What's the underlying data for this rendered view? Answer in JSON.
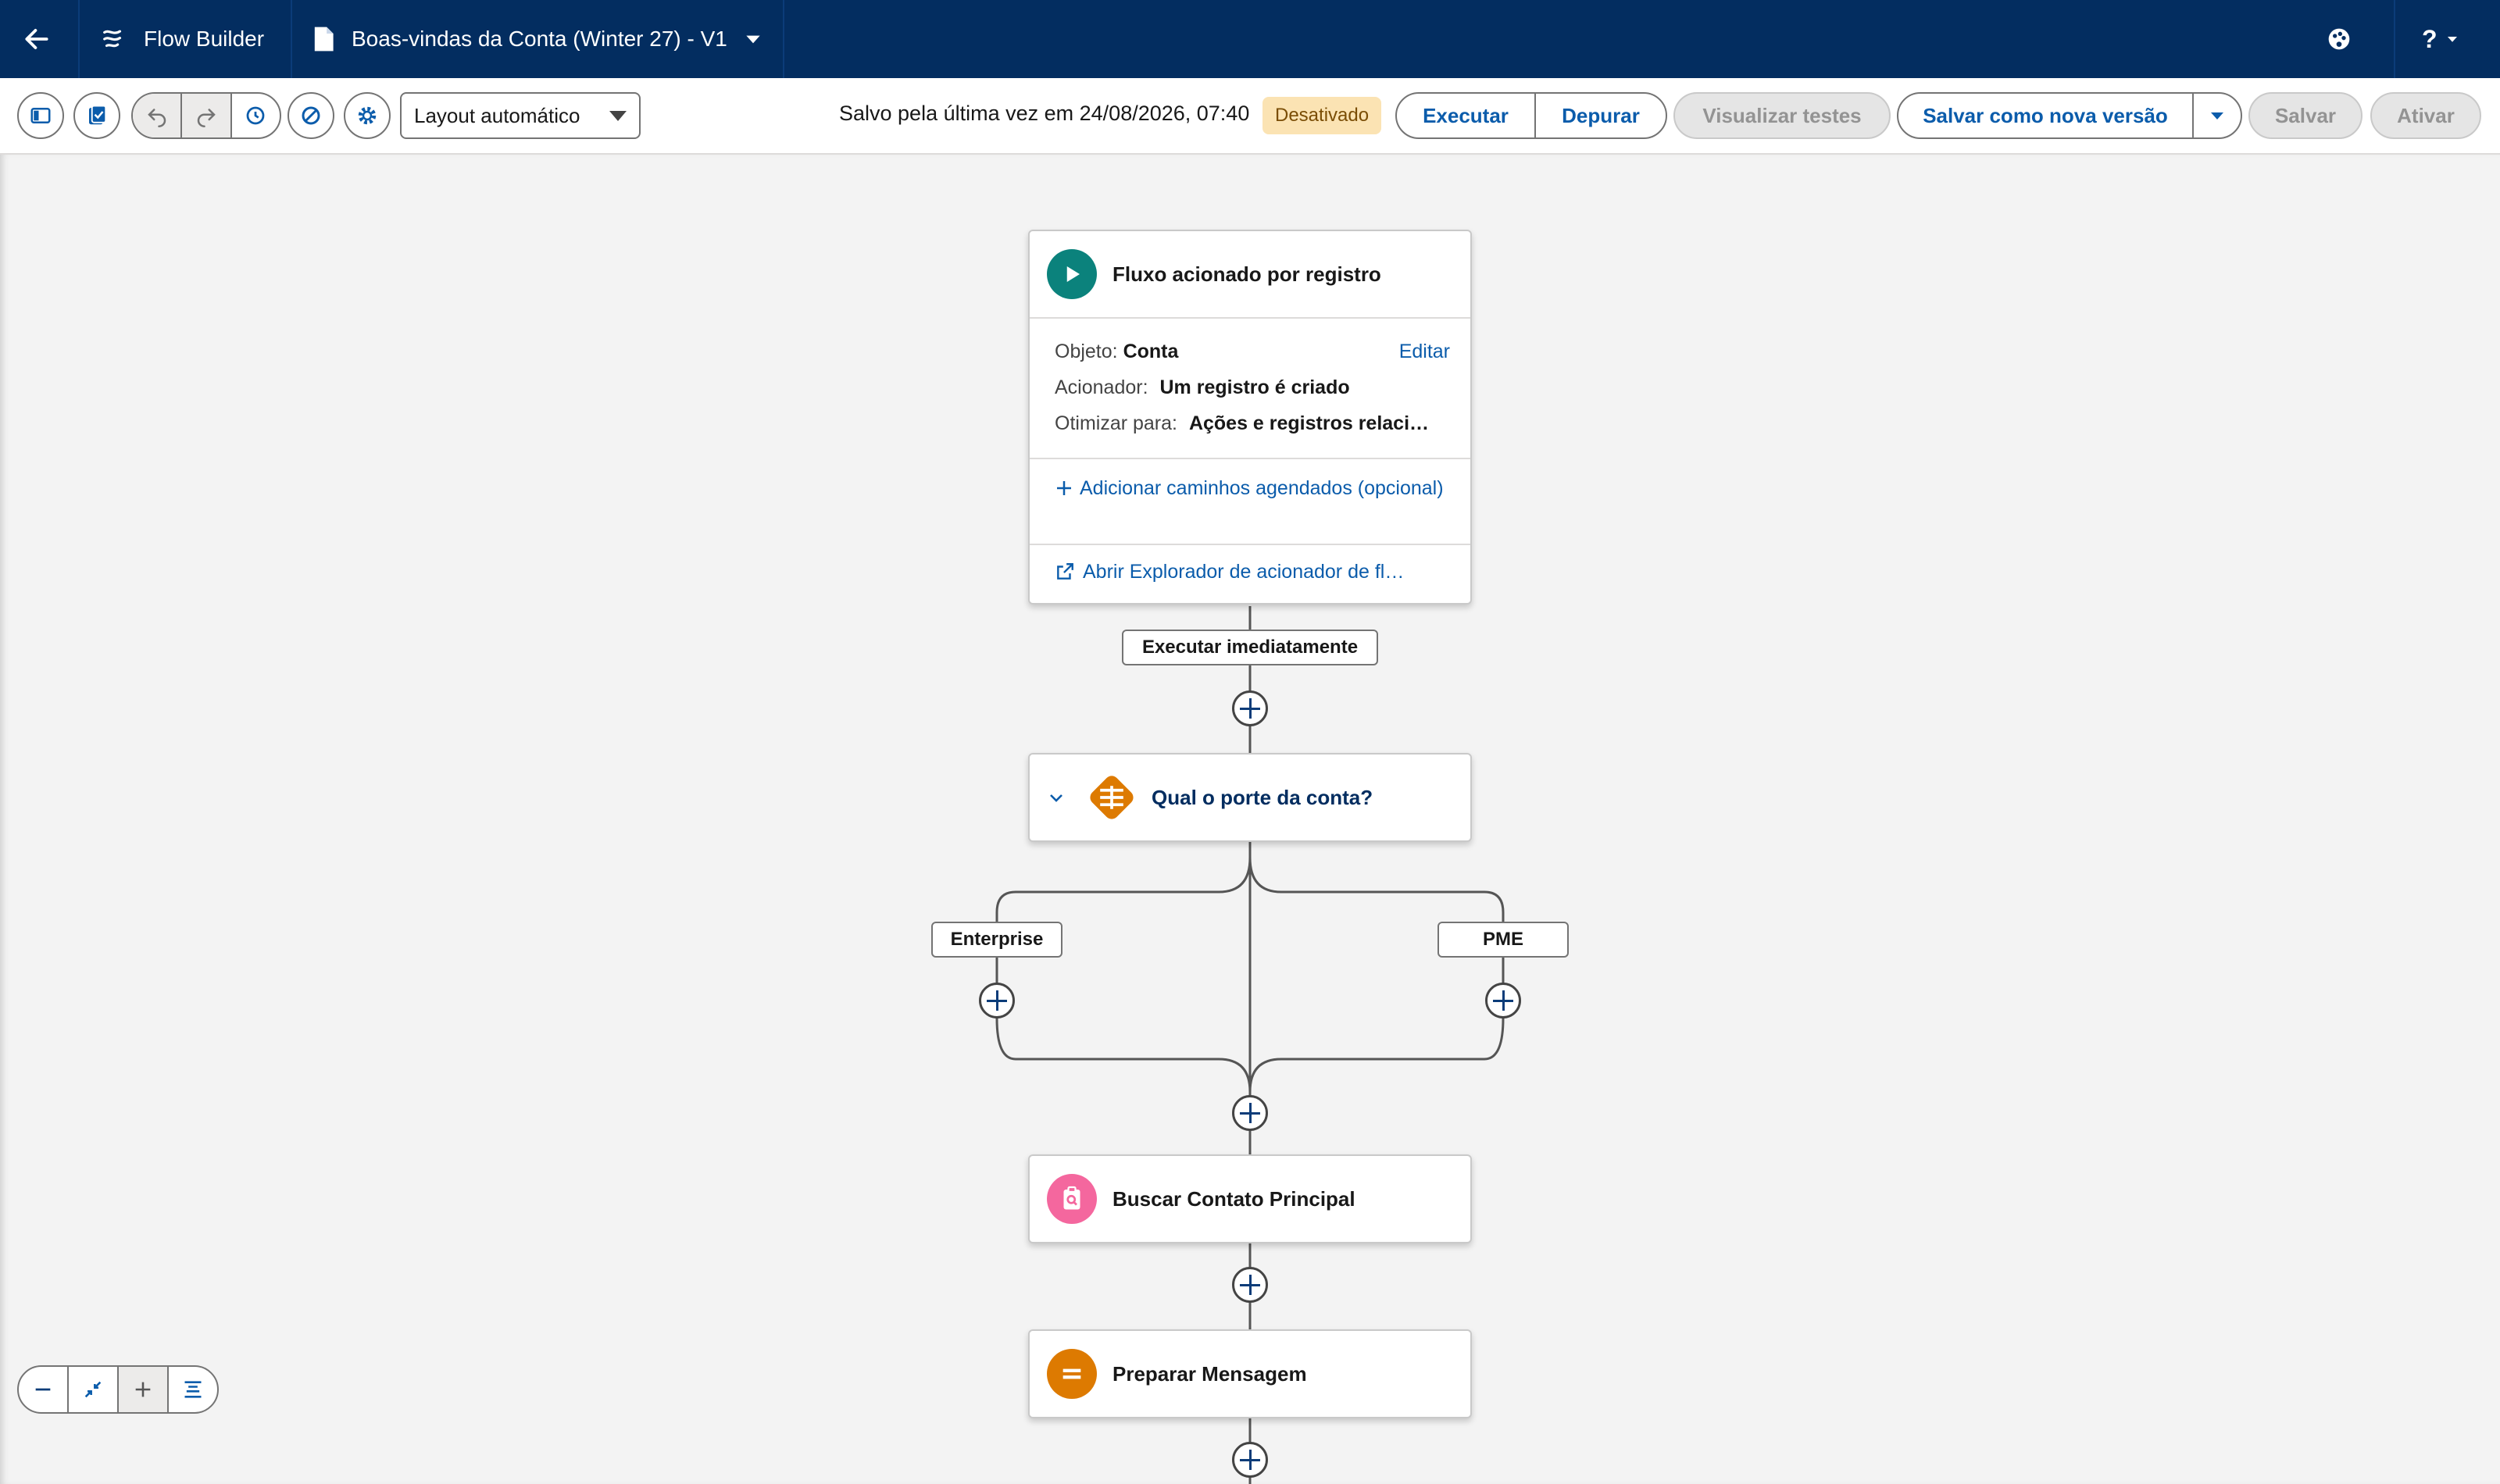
{
  "topbar": {
    "app_name": "Flow Builder",
    "flow_title": "Boas-vindas da Conta (Winter 27) - V1",
    "help_label": "?"
  },
  "toolbar": {
    "layout_select": "Layout automático",
    "saved_text": "Salvo pela última vez em 24/08/2026, 07:40",
    "status_badge": "Desativado",
    "run": "Executar",
    "debug": "Depurar",
    "view_tests": "Visualizar testes",
    "save_as_new": "Salvar como nova versão",
    "save": "Salvar",
    "activate": "Ativar"
  },
  "flow": {
    "start": {
      "title": "Fluxo acionado por registro",
      "object_label": "Objeto:",
      "object_value": "Conta",
      "edit": "Editar",
      "trigger_label": "Acionador:",
      "trigger_value": "Um registro é criado",
      "optimize_label": "Otimizar para:",
      "optimize_value": "Ações e registros relaci…",
      "add_scheduled": "Adicionar caminhos agendados (opcional)",
      "open_explorer": "Abrir Explorador de acionador de fl…"
    },
    "path_label": "Executar imediatamente",
    "decision": {
      "title": "Qual o porte da conta?"
    },
    "branches": [
      "Enterprise",
      "PME"
    ],
    "get_records": {
      "title": "Buscar Contato Principal"
    },
    "assignment": {
      "title": "Preparar Mensagem"
    }
  },
  "colors": {
    "topbar": "#032d60",
    "start_icon": "#0b827c",
    "decision_icon": "#dd7a01",
    "get_records_icon": "#f4679e",
    "assignment_icon": "#dd7a01",
    "link": "#0b5cab"
  },
  "icons": {
    "back": "arrow-left-icon",
    "app": "flow-icon",
    "file": "document-icon",
    "theme": "palette-icon"
  }
}
